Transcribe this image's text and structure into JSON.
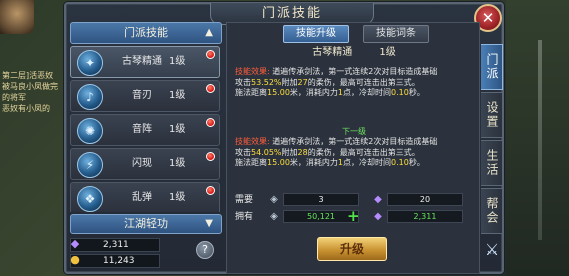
{
  "world": {
    "left_text": [
      "第二层]活恶奴",
      "被马良小凤做完",
      "的将军",
      "恶奴有小凤的"
    ]
  },
  "panel": {
    "title": "门派技能",
    "close_glyph": "✕"
  },
  "left": {
    "header": "门派技能",
    "header_caret": "▲",
    "skills": [
      {
        "icon": "✦",
        "name": "古琴精通",
        "level": "1级",
        "selected": true
      },
      {
        "icon": "♪",
        "name": "音刃",
        "level": "1级",
        "selected": false
      },
      {
        "icon": "✺",
        "name": "音阵",
        "level": "1级",
        "selected": false
      },
      {
        "icon": "⚡",
        "name": "闪现",
        "level": "1级",
        "selected": false
      },
      {
        "icon": "❖",
        "name": "乱弹",
        "level": "1级",
        "selected": false
      }
    ],
    "sub_header": "江湖轻功",
    "sub_caret": "▼",
    "currency": [
      {
        "icon": "◆",
        "value": "2,311"
      },
      {
        "icon": "●",
        "value": "11,243"
      }
    ],
    "help": "?"
  },
  "right": {
    "tabs": [
      {
        "label": "技能升级",
        "active": true
      },
      {
        "label": "技能词条",
        "active": false
      }
    ],
    "current_skill": {
      "name": "古琴精通",
      "level": "1级"
    },
    "current_desc": {
      "tag": "技能效果:",
      "line1": "遒遍传承剑法，第一式连续2次对目标造成基础",
      "line2a": "攻击",
      "pct": "53.52%",
      "line2b": "附加",
      "add": "27",
      "line2c": "的柔伤，最高可连击出第三式。",
      "line3a": "施法距离",
      "range": "15.00",
      "line3b": "米，消耗内力",
      "mp": "1",
      "line3c": "点，冷却时间",
      "cd": "0.10",
      "line3d": "秒。"
    },
    "next_label": "下一级",
    "next_desc": {
      "tag": "技能效果:",
      "line1": "遒遍传承剑法，第一式连续2次对目标造成基础",
      "line2a": "攻击",
      "pct": "54.05%",
      "line2b": "附加",
      "add": "28",
      "line2c": "的柔伤，最高可连击出第三式。",
      "line3a": "施法距离",
      "range": "15.00",
      "line3b": "米，消耗内力",
      "mp": "1",
      "line3c": "点，冷却时间",
      "cd": "0.10",
      "line3d": "秒。"
    },
    "need_label": "需要",
    "have_label": "拥有",
    "need": {
      "a": "3",
      "b": "20"
    },
    "have": {
      "a": "50,121",
      "b": "2,311"
    },
    "plus": "+",
    "upgrade_button": "升级"
  },
  "vtabs": [
    {
      "label": "门派",
      "active": true
    },
    {
      "label": "设置",
      "active": false
    },
    {
      "label": "生活",
      "active": false
    },
    {
      "label": "帮会",
      "active": false
    }
  ],
  "colors": {
    "accent_blue": "#2f5381",
    "red_text": "#ff5d3c",
    "yellow_hl": "#ffdf3a",
    "green": "#6fe35f",
    "gold_button": "#c58e2e"
  }
}
